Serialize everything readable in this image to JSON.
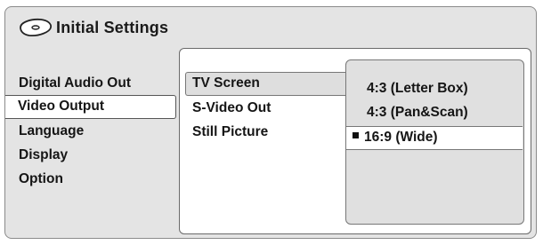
{
  "title": {
    "text": "Initial Settings",
    "icon": "disc-icon"
  },
  "left_menu": {
    "items": [
      {
        "label": "Digital Audio Out",
        "selected": false
      },
      {
        "label": "Video Output",
        "selected": true
      },
      {
        "label": "Language",
        "selected": false
      },
      {
        "label": "Display",
        "selected": false
      },
      {
        "label": "Option",
        "selected": false
      }
    ]
  },
  "mid_menu": {
    "items": [
      {
        "label": "TV Screen",
        "selected": true
      },
      {
        "label": "S-Video Out",
        "selected": false
      },
      {
        "label": "Still Picture",
        "selected": false
      }
    ]
  },
  "options": {
    "items": [
      {
        "label": "4:3 (Letter Box)",
        "selected": false
      },
      {
        "label": "4:3 (Pan&Scan)",
        "selected": false
      },
      {
        "label": "16:9 (Wide)",
        "selected": true
      }
    ]
  },
  "colors": {
    "frame_bg": "#e4e4e4",
    "panel_bg": "#ffffff",
    "subpanel_bg": "#e0e0e0",
    "highlight": "#ffffff",
    "text": "#151515"
  }
}
